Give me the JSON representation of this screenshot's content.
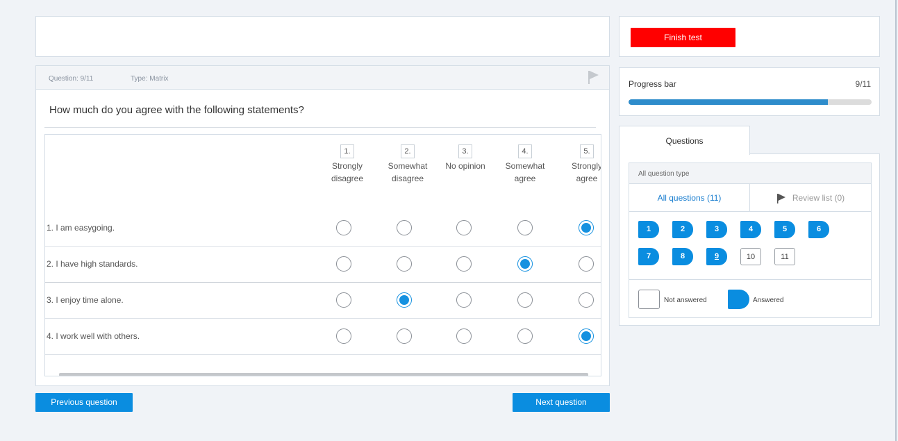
{
  "question": {
    "number_label": "Question: 9/11",
    "type_label": "Type: Matrix",
    "title": "How much do you agree with the following statements?",
    "columns": [
      {
        "num": "1.",
        "line1": "Strongly",
        "line2": "disagree"
      },
      {
        "num": "2.",
        "line1": "Somewhat",
        "line2": "disagree"
      },
      {
        "num": "3.",
        "line1": "No opinion",
        "line2": ""
      },
      {
        "num": "4.",
        "line1": "Somewhat",
        "line2": "agree"
      },
      {
        "num": "5.",
        "line1": "Strongly",
        "line2": "agree"
      }
    ],
    "rows": [
      {
        "label": "1.   I am easygoing.",
        "selected": 5
      },
      {
        "label": "2.   I have high standards.",
        "selected": 4
      },
      {
        "label": "3.   I enjoy time alone.",
        "selected": 2
      },
      {
        "label": "4.   I work well with others.",
        "selected": 5
      }
    ]
  },
  "nav": {
    "prev_label": "Previous question",
    "next_label": "Next question"
  },
  "finish": {
    "label": "Finish test"
  },
  "progress": {
    "label": "Progress bar",
    "count": "9/11",
    "fraction": 0.82
  },
  "questions_panel": {
    "tab_label": "Questions",
    "type_filter": "All question type",
    "all_label": "All questions (11)",
    "review_label": "Review list (0)",
    "items": [
      {
        "n": "1",
        "answered": true
      },
      {
        "n": "2",
        "answered": true
      },
      {
        "n": "3",
        "answered": true
      },
      {
        "n": "4",
        "answered": true
      },
      {
        "n": "5",
        "answered": true
      },
      {
        "n": "6",
        "answered": true
      },
      {
        "n": "7",
        "answered": true
      },
      {
        "n": "8",
        "answered": true
      },
      {
        "n": "9",
        "answered": true
      },
      {
        "n": "10",
        "answered": false
      },
      {
        "n": "11",
        "answered": false
      }
    ],
    "legend_unanswered": "Not answered",
    "legend_answered": "Answered"
  },
  "colors": {
    "accent": "#0a8de0",
    "finish": "#ff0000",
    "progress": "#2e8ccb"
  }
}
